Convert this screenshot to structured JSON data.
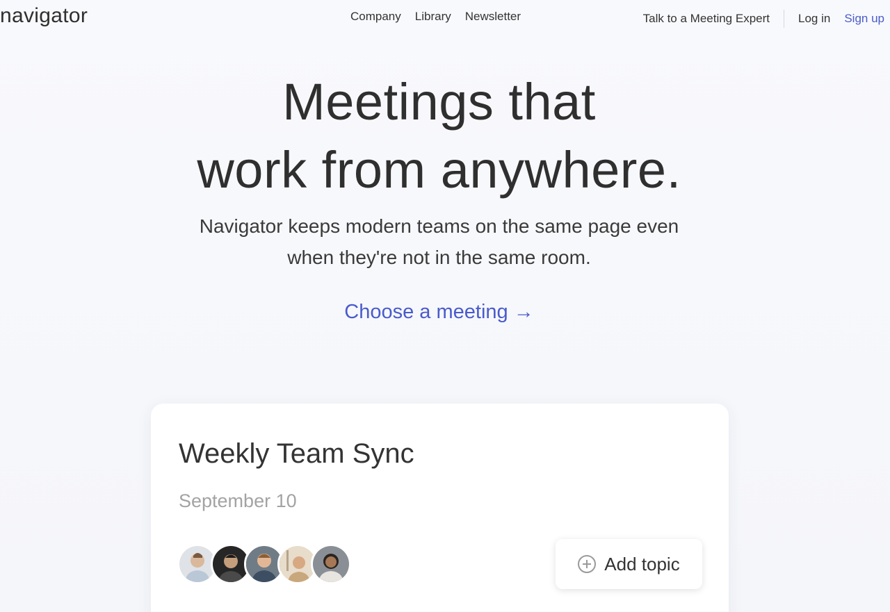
{
  "header": {
    "logo": "navigator",
    "nav": [
      "Company",
      "Library",
      "Newsletter"
    ],
    "talk_to_expert": "Talk to a Meeting Expert",
    "login": "Log in",
    "signup": "Sign up"
  },
  "hero": {
    "title_line1": "Meetings that",
    "title_line2": "work from anywhere.",
    "subtitle_line1": "Navigator keeps modern teams on the same page even",
    "subtitle_line2": "when they're not in the same room.",
    "cta": "Choose a meeting →"
  },
  "card": {
    "title": "Weekly Team Sync",
    "date": "September 10",
    "add_topic": "Add topic",
    "avatars": [
      "avatar-1",
      "avatar-2",
      "avatar-3",
      "avatar-4",
      "avatar-5"
    ]
  },
  "colors": {
    "accent": "#4a5bcb",
    "text": "#333333",
    "muted": "#a3a3a3",
    "background": "#f8f9fc"
  }
}
